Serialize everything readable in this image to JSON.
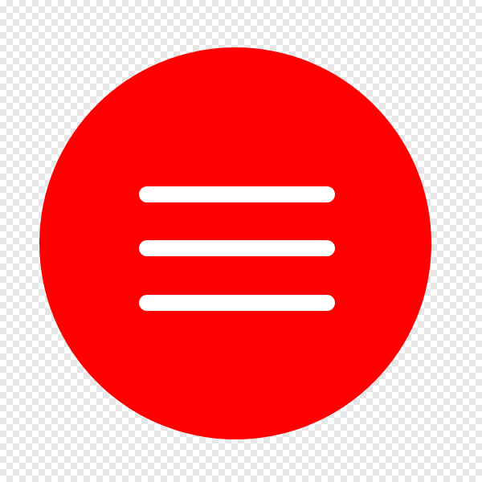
{
  "icon": {
    "name": "hamburger-menu-icon",
    "shape": "circle",
    "lines": 3,
    "background": "checkerboard-transparency"
  },
  "colors": {
    "accent": "#ff0000",
    "glyph": "#ffffff",
    "checker_light": "#ffffff",
    "checker_dark": "#e6e6e6"
  }
}
